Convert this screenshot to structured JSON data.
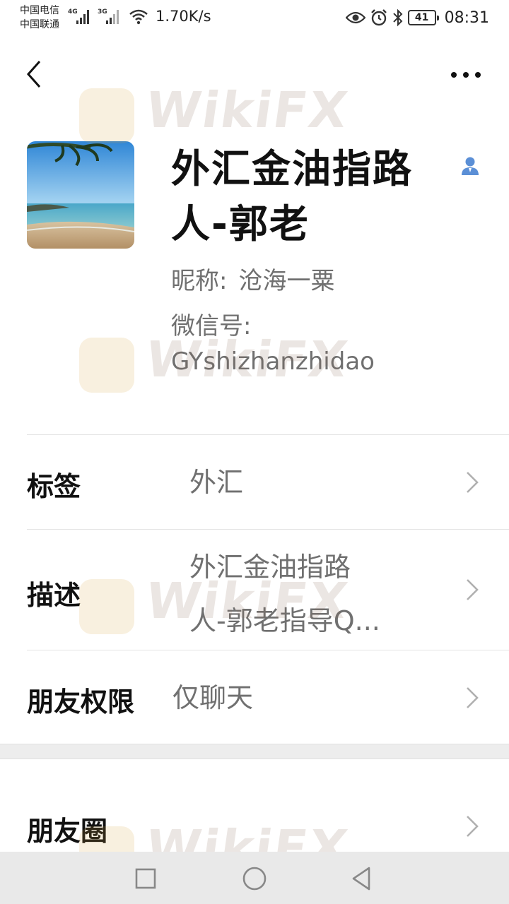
{
  "status_bar": {
    "carrier_1": "中国电信",
    "carrier_2": "中国联通",
    "sim1_tag": "4G",
    "sim2_tag": "3G",
    "net_speed": "1.70K/s",
    "battery_level": "41",
    "time": "08:31"
  },
  "profile": {
    "display_name": "外汇金油指路人-郭老",
    "nickname_label": "昵称:",
    "nickname": "沧海一粟",
    "wechat_id_label": "微信号:",
    "wechat_id": "GYshizhanzhidao"
  },
  "rows": [
    {
      "label": "标签",
      "value": "外汇"
    },
    {
      "label": "描述",
      "value_line1": "外汇金油指路",
      "value_line2": "人-郭老指导Q..."
    },
    {
      "label": "朋友权限",
      "value": "仅聊天"
    },
    {
      "label": "朋友圈"
    }
  ],
  "watermark": {
    "text": "WikiFX"
  },
  "icons": {
    "back": "chevron-left-icon",
    "more": "more-dots-icon",
    "contact_badge": "person-icon",
    "row_arrow": "chevron-right-icon"
  },
  "colors": {
    "background": "#ffffff",
    "secondary_text": "#707070",
    "badge_blue": "#5b8fd6",
    "nav_bar": "#e9e9e9"
  }
}
